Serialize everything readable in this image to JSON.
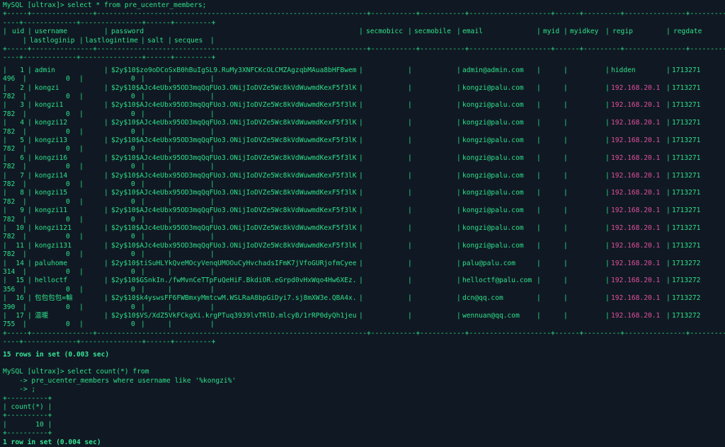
{
  "colors": {
    "background": "#101923",
    "text": "#2ee08a",
    "ip": "#e0509e"
  },
  "query1": {
    "prompt": "MySQL [ultrax]>",
    "command": "select * from pre_ucenter_members;",
    "sep_top_a": "+-----+---------------+------------------------------------------------------------------+-----------+-----------+--------------------+------+---------+---------------+---------",
    "sep_top_b": "----+-------------+---------------+------+---------+",
    "headers": [
      "uid",
      "username",
      "password",
      "secmobicc",
      "secmobile",
      "email",
      "myid",
      "myidkey",
      "regip",
      "regdate",
      "lastloginip",
      "lastlogintime",
      "salt",
      "secques"
    ],
    "rows": [
      {
        "uid": "1",
        "username": "admin",
        "password": "$2y$10$zo9oDCoSxB0hBuIgSL9.RuMy3XNFCKcOLCMZAgzqbMAua8bHFBwem",
        "email": "admin@admin.com",
        "regip": "hidden",
        "regdate_a": "1713271",
        "regdate_b": "496",
        "lastloginip": "0",
        "lastlogintime": "0"
      },
      {
        "uid": "2",
        "username": "kongzi",
        "password": "$2y$10$AJc4eUbx95OD3mqQqFUo3.ONijIoDVZe5Wc8kVdWuwmdKexF5f3lK",
        "email": "kongzi@palu.com",
        "regip": "192.168.20.1",
        "regdate_a": "1713271",
        "regdate_b": "782",
        "lastloginip": "0",
        "lastlogintime": "0"
      },
      {
        "uid": "3",
        "username": "kongzi1",
        "password": "$2y$10$AJc4eUbx95OD3mqQqFUo3.ONijIoDVZe5Wc8kVdWuwmdKexF5f3lK",
        "email": "kongzi@palu.com",
        "regip": "192.168.20.1",
        "regdate_a": "1713271",
        "regdate_b": "782",
        "lastloginip": "0",
        "lastlogintime": "0"
      },
      {
        "uid": "4",
        "username": "kongzi12",
        "password": "$2y$10$AJc4eUbx95OD3mqQqFUo3.ONijIoDVZe5Wc8kVdWuwmdKexF5f3lK",
        "email": "kongzi@palu.com",
        "regip": "192.168.20.1",
        "regdate_a": "1713271",
        "regdate_b": "782",
        "lastloginip": "0",
        "lastlogintime": "0"
      },
      {
        "uid": "5",
        "username": "kongzi13",
        "password": "$2y$10$AJc4eUbx95OD3mqQqFUo3.ONijIoDVZe5Wc8kVdWuwmdKexF5f3lK",
        "email": "kongzi@palu.com",
        "regip": "192.168.20.1",
        "regdate_a": "1713271",
        "regdate_b": "782",
        "lastloginip": "0",
        "lastlogintime": "0"
      },
      {
        "uid": "6",
        "username": "kongzi16",
        "password": "$2y$10$AJc4eUbx95OD3mqQqFUo3.ONijIoDVZe5Wc8kVdWuwmdKexF5f3lK",
        "email": "kongzi@palu.com",
        "regip": "192.168.20.1",
        "regdate_a": "1713271",
        "regdate_b": "782",
        "lastloginip": "0",
        "lastlogintime": "0"
      },
      {
        "uid": "7",
        "username": "kongzi14",
        "password": "$2y$10$AJc4eUbx95OD3mqQqFUo3.ONijIoDVZe5Wc8kVdWuwmdKexF5f3lK",
        "email": "kongzi@palu.com",
        "regip": "192.168.20.1",
        "regdate_a": "1713271",
        "regdate_b": "782",
        "lastloginip": "0",
        "lastlogintime": "0"
      },
      {
        "uid": "8",
        "username": "kongzi15",
        "password": "$2y$10$AJc4eUbx95OD3mqQqFUo3.ONijIoDVZe5Wc8kVdWuwmdKexF5f3lK",
        "email": "kongzi@palu.com",
        "regip": "192.168.20.1",
        "regdate_a": "1713271",
        "regdate_b": "782",
        "lastloginip": "0",
        "lastlogintime": "0"
      },
      {
        "uid": "9",
        "username": "kongzi11",
        "password": "$2y$10$AJc4eUbx95OD3mqQqFUo3.ONijIoDVZe5Wc8kVdWuwmdKexF5f3lK",
        "email": "kongzi@palu.com",
        "regip": "192.168.20.1",
        "regdate_a": "1713271",
        "regdate_b": "782",
        "lastloginip": "0",
        "lastlogintime": "0"
      },
      {
        "uid": "10",
        "username": "kongzi121",
        "password": "$2y$10$AJc4eUbx95OD3mqQqFUo3.ONijIoDVZe5Wc8kVdWuwmdKexF5f3lK",
        "email": "kongzi@palu.com",
        "regip": "192.168.20.1",
        "regdate_a": "1713271",
        "regdate_b": "782",
        "lastloginip": "0",
        "lastlogintime": "0"
      },
      {
        "uid": "11",
        "username": "kongzi131",
        "password": "$2y$10$AJc4eUbx95OD3mqQqFUo3.ONijIoDVZe5Wc8kVdWuwmdKexF5f3lK",
        "email": "kongzi@palu.com",
        "regip": "192.168.20.1",
        "regdate_a": "1713271",
        "regdate_b": "782",
        "lastloginip": "0",
        "lastlogintime": "0"
      },
      {
        "uid": "14",
        "username": "paluhome",
        "password": "$2y$10$tiSuHLYkQveMOcyVenqUMOOuCyHvchadsIFmK7jVfoGURjofmCyee",
        "email": "palu@palu.com",
        "regip": "192.168.20.1",
        "regdate_a": "1713272",
        "regdate_b": "314",
        "lastloginip": "0",
        "lastlogintime": "0"
      },
      {
        "uid": "15",
        "username": "helloctf",
        "password": "$2y$10$GSnkIn./fwMvnCeTTpFuQeHiF.BkdiOR.eGrpd0vHxWqo4Hw6XEz.",
        "email": "helloctf@palu.com",
        "regip": "192.168.20.1",
        "regdate_a": "1713272",
        "regdate_b": "356",
        "lastloginip": "0",
        "lastlogintime": "0"
      },
      {
        "uid": "16",
        "username": "包包包包=輸",
        "password": "$2y$10$k4yswsFF6FWBmxyMmtcwM.WSLRaA8bpGiDyi7.sj8mXW3e.QBA4x.",
        "email": "dcn@qq.com",
        "regip": "192.168.20.1",
        "regdate_a": "1713272",
        "regdate_b": "390",
        "lastloginip": "0",
        "lastlogintime": "0"
      },
      {
        "uid": "17",
        "username": "温暖",
        "password": "$2y$10$VS/XdZ5VkFCkgXi.krgPTuq3939lvTRlD.mlcyB/1rRP0dyQh1jeu",
        "email": "wennuan@qq.com",
        "regip": "192.168.20.1",
        "regdate_a": "1713272",
        "regdate_b": "755",
        "lastloginip": "0",
        "lastlogintime": "0"
      }
    ],
    "result": "15 rows in set (0.003 sec)"
  },
  "query2": {
    "prompt": "MySQL [ultrax]>",
    "command": "select count(*) from",
    "cont1": "    -> pre_ucenter_members where username like '%kongzi%'",
    "cont2": "    -> ;",
    "sep": "+----------+",
    "header": "| count(*) |",
    "value_row": "|       10 |",
    "count_value": "10",
    "result": "1 row in set (0.004 sec)"
  }
}
